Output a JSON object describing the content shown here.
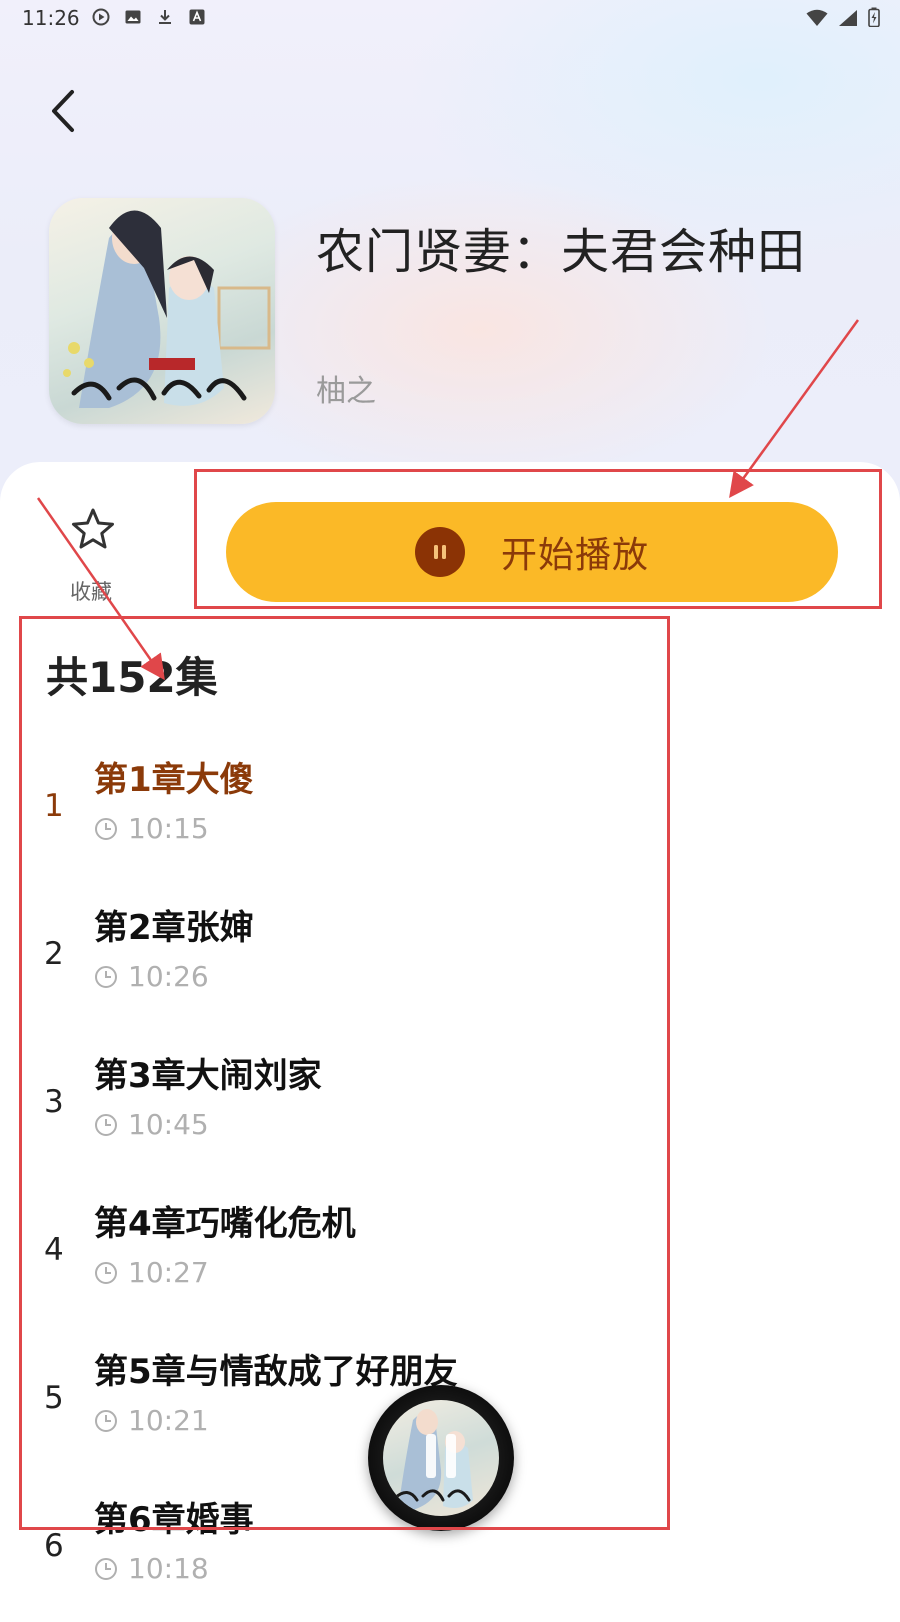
{
  "status": {
    "time": "11:26"
  },
  "book": {
    "title": "农门贤妻：夫君会种田",
    "author": "柚之"
  },
  "actions": {
    "favorite_label": "收藏",
    "play_label": "开始播放"
  },
  "episodes": {
    "count_label": "共152集",
    "items": [
      {
        "num": "1",
        "title": "第1章大傻",
        "duration": "10:15",
        "active": true
      },
      {
        "num": "2",
        "title": "第2章张婶",
        "duration": "10:26"
      },
      {
        "num": "3",
        "title": "第3章大闹刘家",
        "duration": "10:45"
      },
      {
        "num": "4",
        "title": "第4章巧嘴化危机",
        "duration": "10:27"
      },
      {
        "num": "5",
        "title": "第5章与情敌成了好朋友",
        "duration": "10:21"
      },
      {
        "num": "6",
        "title": "第6章婚事",
        "duration": "10:18"
      }
    ]
  },
  "colors": {
    "accent": "#fbb927",
    "accent_text": "#8b3a09",
    "annotation": "#e0474a"
  }
}
